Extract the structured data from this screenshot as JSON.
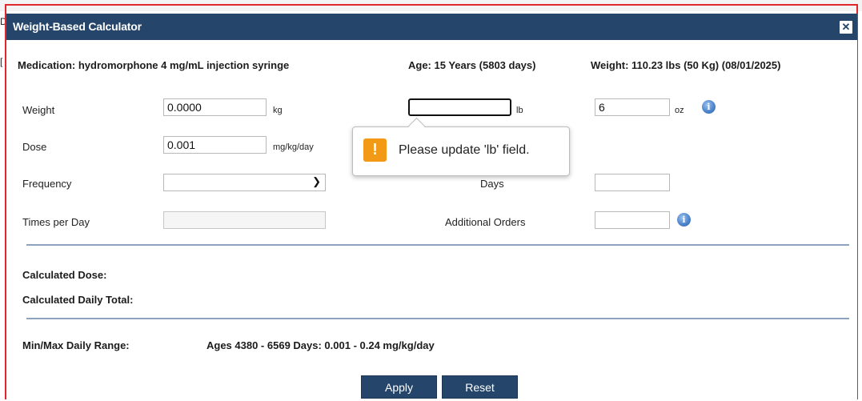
{
  "dialog": {
    "title": "Weight-Based Calculator",
    "close_label": "✕"
  },
  "patient": {
    "medication": "Medication: hydromorphone 4 mg/mL injection syringe",
    "age": "Age: 15 Years (5803 days)",
    "weight": "Weight: 110.23 lbs (50 Kg) (08/01/2025)"
  },
  "form": {
    "weight_label": "Weight",
    "weight_kg_value": "0.0000",
    "kg_unit": "kg",
    "weight_lb_value": "",
    "lb_unit": "lb",
    "weight_oz_value": "6",
    "oz_unit": "oz",
    "dose_label": "Dose",
    "dose_value": "0.001",
    "dose_unit": "mg/kg/day",
    "frequency_label": "Frequency",
    "frequency_value": "",
    "days_label": "Days",
    "days_value": "",
    "times_per_day_label": "Times per Day",
    "times_per_day_value": "",
    "additional_orders_label": "Additional Orders",
    "additional_orders_value": ""
  },
  "validation": {
    "message": "Please update 'lb' field.",
    "icon_glyph": "!"
  },
  "results": {
    "calculated_dose_label": "Calculated Dose:",
    "calculated_daily_total_label": "Calculated Daily Total:",
    "min_max_label": "Min/Max Daily Range:",
    "min_max_value": "Ages 4380 - 6569 Days: 0.001 - 0.24 mg/kg/day"
  },
  "buttons": {
    "apply": "Apply",
    "reset": "Reset"
  },
  "colors": {
    "titlebar": "#25466a",
    "button": "#25466a",
    "separator": "#8ea3bd",
    "frame": "#e1262d",
    "warning": "#f29a16",
    "info_icon": "#4f86cc"
  },
  "icons": {
    "close": "close-icon",
    "info": "info-icon",
    "dropdown": "chevron-down-icon",
    "warning": "warning-icon"
  }
}
